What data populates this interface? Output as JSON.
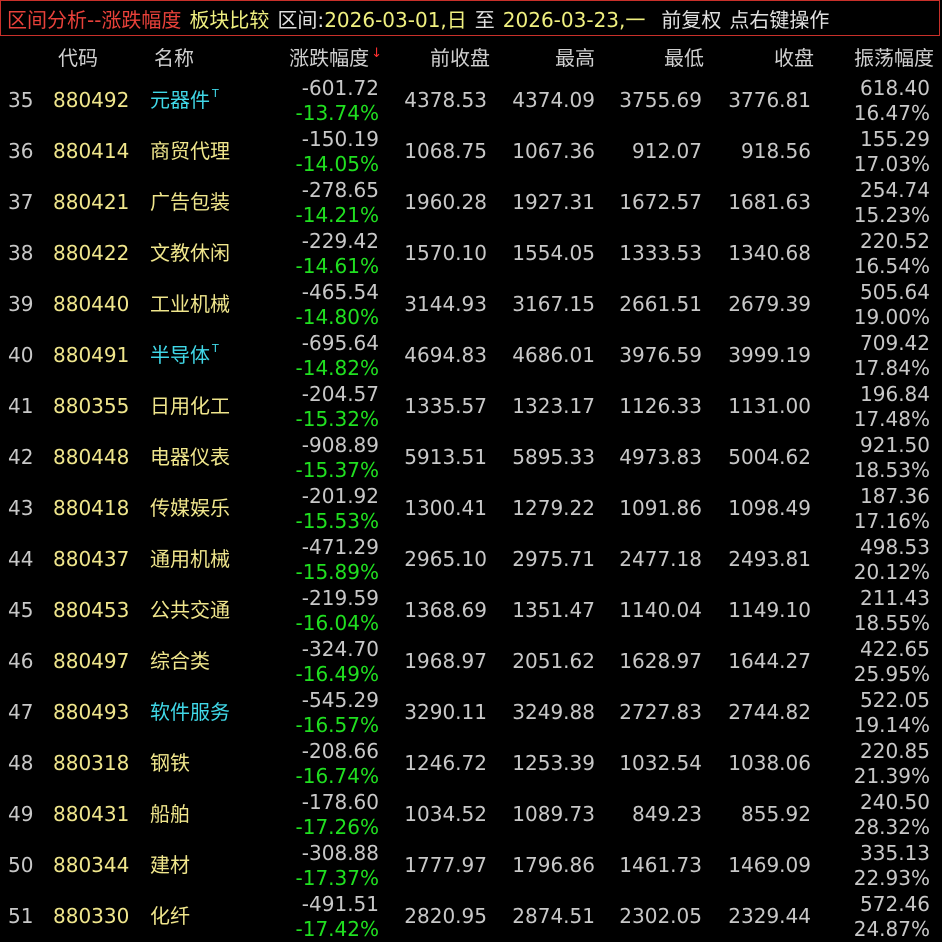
{
  "title": {
    "main": "区间分析--涨跌幅度",
    "mode": "板块比较",
    "range_label": "区间:",
    "start": "2026-03-01,日",
    "to": "至",
    "end": "2026-03-23,一",
    "adjust": "前复权",
    "hint": "点右键操作"
  },
  "columns": {
    "code": "代码",
    "name": "名称",
    "change": "涨跌幅度",
    "sort_arrow": "↓",
    "prev_close": "前收盘",
    "high": "最高",
    "low": "最低",
    "close": "收盘",
    "amplitude": "振荡幅度"
  },
  "rows": [
    {
      "idx": "35",
      "code": "880492",
      "name": "元器件",
      "tmark": "T",
      "cyan": true,
      "chg": "-601.72",
      "pct": "-13.74%",
      "prev": "4378.53",
      "high": "4374.09",
      "low": "3755.69",
      "close": "3776.81",
      "amp": "618.40",
      "ampp": "16.47%"
    },
    {
      "idx": "36",
      "code": "880414",
      "name": "商贸代理",
      "tmark": "",
      "cyan": false,
      "chg": "-150.19",
      "pct": "-14.05%",
      "prev": "1068.75",
      "high": "1067.36",
      "low": "912.07",
      "close": "918.56",
      "amp": "155.29",
      "ampp": "17.03%"
    },
    {
      "idx": "37",
      "code": "880421",
      "name": "广告包装",
      "tmark": "",
      "cyan": false,
      "chg": "-278.65",
      "pct": "-14.21%",
      "prev": "1960.28",
      "high": "1927.31",
      "low": "1672.57",
      "close": "1681.63",
      "amp": "254.74",
      "ampp": "15.23%"
    },
    {
      "idx": "38",
      "code": "880422",
      "name": "文教休闲",
      "tmark": "",
      "cyan": false,
      "chg": "-229.42",
      "pct": "-14.61%",
      "prev": "1570.10",
      "high": "1554.05",
      "low": "1333.53",
      "close": "1340.68",
      "amp": "220.52",
      "ampp": "16.54%"
    },
    {
      "idx": "39",
      "code": "880440",
      "name": "工业机械",
      "tmark": "",
      "cyan": false,
      "chg": "-465.54",
      "pct": "-14.80%",
      "prev": "3144.93",
      "high": "3167.15",
      "low": "2661.51",
      "close": "2679.39",
      "amp": "505.64",
      "ampp": "19.00%"
    },
    {
      "idx": "40",
      "code": "880491",
      "name": "半导体",
      "tmark": "T",
      "cyan": true,
      "chg": "-695.64",
      "pct": "-14.82%",
      "prev": "4694.83",
      "high": "4686.01",
      "low": "3976.59",
      "close": "3999.19",
      "amp": "709.42",
      "ampp": "17.84%"
    },
    {
      "idx": "41",
      "code": "880355",
      "name": "日用化工",
      "tmark": "",
      "cyan": false,
      "chg": "-204.57",
      "pct": "-15.32%",
      "prev": "1335.57",
      "high": "1323.17",
      "low": "1126.33",
      "close": "1131.00",
      "amp": "196.84",
      "ampp": "17.48%"
    },
    {
      "idx": "42",
      "code": "880448",
      "name": "电器仪表",
      "tmark": "",
      "cyan": false,
      "chg": "-908.89",
      "pct": "-15.37%",
      "prev": "5913.51",
      "high": "5895.33",
      "low": "4973.83",
      "close": "5004.62",
      "amp": "921.50",
      "ampp": "18.53%"
    },
    {
      "idx": "43",
      "code": "880418",
      "name": "传媒娱乐",
      "tmark": "",
      "cyan": false,
      "chg": "-201.92",
      "pct": "-15.53%",
      "prev": "1300.41",
      "high": "1279.22",
      "low": "1091.86",
      "close": "1098.49",
      "amp": "187.36",
      "ampp": "17.16%"
    },
    {
      "idx": "44",
      "code": "880437",
      "name": "通用机械",
      "tmark": "",
      "cyan": false,
      "chg": "-471.29",
      "pct": "-15.89%",
      "prev": "2965.10",
      "high": "2975.71",
      "low": "2477.18",
      "close": "2493.81",
      "amp": "498.53",
      "ampp": "20.12%"
    },
    {
      "idx": "45",
      "code": "880453",
      "name": "公共交通",
      "tmark": "",
      "cyan": false,
      "chg": "-219.59",
      "pct": "-16.04%",
      "prev": "1368.69",
      "high": "1351.47",
      "low": "1140.04",
      "close": "1149.10",
      "amp": "211.43",
      "ampp": "18.55%"
    },
    {
      "idx": "46",
      "code": "880497",
      "name": "综合类",
      "tmark": "",
      "cyan": false,
      "chg": "-324.70",
      "pct": "-16.49%",
      "prev": "1968.97",
      "high": "2051.62",
      "low": "1628.97",
      "close": "1644.27",
      "amp": "422.65",
      "ampp": "25.95%"
    },
    {
      "idx": "47",
      "code": "880493",
      "name": "软件服务",
      "tmark": "",
      "cyan": true,
      "chg": "-545.29",
      "pct": "-16.57%",
      "prev": "3290.11",
      "high": "3249.88",
      "low": "2727.83",
      "close": "2744.82",
      "amp": "522.05",
      "ampp": "19.14%"
    },
    {
      "idx": "48",
      "code": "880318",
      "name": "钢铁",
      "tmark": "",
      "cyan": false,
      "chg": "-208.66",
      "pct": "-16.74%",
      "prev": "1246.72",
      "high": "1253.39",
      "low": "1032.54",
      "close": "1038.06",
      "amp": "220.85",
      "ampp": "21.39%"
    },
    {
      "idx": "49",
      "code": "880431",
      "name": "船舶",
      "tmark": "",
      "cyan": false,
      "chg": "-178.60",
      "pct": "-17.26%",
      "prev": "1034.52",
      "high": "1089.73",
      "low": "849.23",
      "close": "855.92",
      "amp": "240.50",
      "ampp": "28.32%"
    },
    {
      "idx": "50",
      "code": "880344",
      "name": "建材",
      "tmark": "",
      "cyan": false,
      "chg": "-308.88",
      "pct": "-17.37%",
      "prev": "1777.97",
      "high": "1796.86",
      "low": "1461.73",
      "close": "1469.09",
      "amp": "335.13",
      "ampp": "22.93%"
    },
    {
      "idx": "51",
      "code": "880330",
      "name": "化纤",
      "tmark": "",
      "cyan": false,
      "chg": "-491.51",
      "pct": "-17.42%",
      "prev": "2820.95",
      "high": "2874.51",
      "low": "2302.05",
      "close": "2329.44",
      "amp": "572.46",
      "ampp": "24.87%"
    }
  ]
}
